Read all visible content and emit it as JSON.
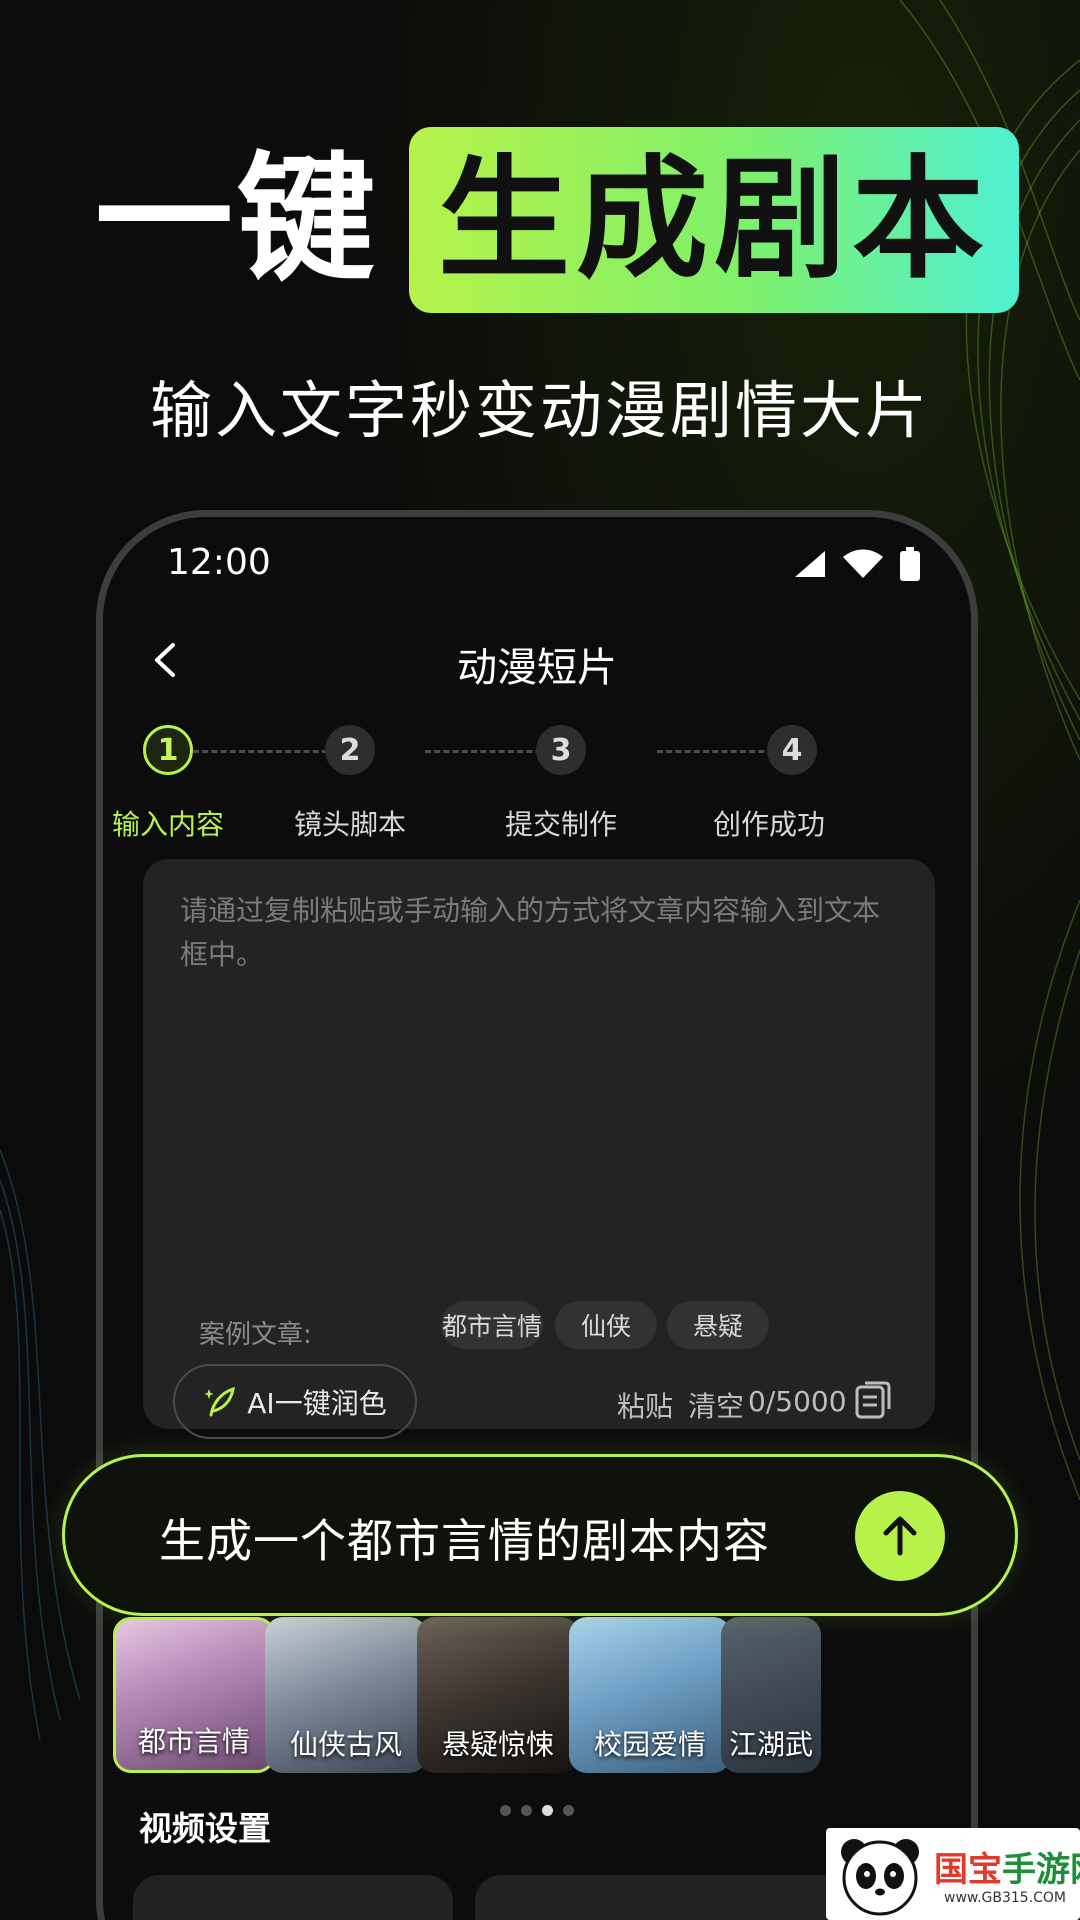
{
  "hero": {
    "title_plain": "一键",
    "title_highlight": "生成剧本",
    "subtitle": "输入文字秒变动漫剧情大片"
  },
  "status_bar": {
    "time": "12:00"
  },
  "header": {
    "title": "动漫短片"
  },
  "steps": [
    {
      "number": "1",
      "label": "输入内容",
      "active": true
    },
    {
      "number": "2",
      "label": "镜头脚本",
      "active": false
    },
    {
      "number": "3",
      "label": "提交制作",
      "active": false
    },
    {
      "number": "4",
      "label": "创作成功",
      "active": false
    }
  ],
  "editor": {
    "placeholder": "请通过复制粘贴或手动输入的方式将文章内容输入到文本框中。",
    "examples_label": "案例文章:",
    "example_tags": [
      "都市言情",
      "仙侠",
      "悬疑"
    ],
    "ai_button": "AI一键润色",
    "paste": "粘贴",
    "clear": "清空",
    "counter": "0/5000"
  },
  "prompt": {
    "text": "生成一个都市言情的剧本内容"
  },
  "styles": [
    {
      "label": "都市言情",
      "selected": true
    },
    {
      "label": "仙侠古风",
      "selected": false
    },
    {
      "label": "悬疑惊悚",
      "selected": false
    },
    {
      "label": "校园爱情",
      "selected": false
    },
    {
      "label": "江湖武",
      "selected": false
    }
  ],
  "carousel": {
    "pages": 4,
    "current": 3
  },
  "video_settings": {
    "title": "视频设置"
  },
  "watermark": {
    "brand_a": "国宝",
    "brand_b": "手游网",
    "url": "www.GB315.COM"
  },
  "colors": {
    "accent": "#b6f24a",
    "accent_gradient_end": "#4ff0d2",
    "background": "#0b0b0b"
  }
}
